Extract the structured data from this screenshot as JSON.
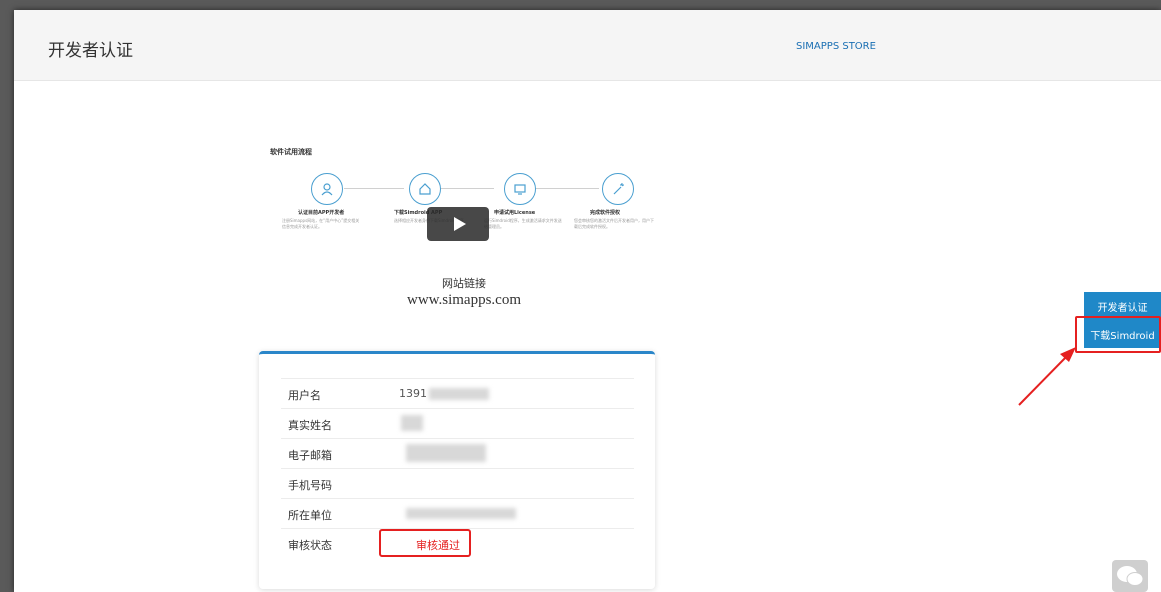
{
  "header": {
    "title": "开发者认证",
    "store_link": "SIMAPPS STORE"
  },
  "flow": {
    "title": "软件试用流程",
    "steps": [
      {
        "title": "认证目前APP开发者",
        "desc": "注册Simapps网站，在“用户中心”提交相关信息完成开发者认证。",
        "icon": "user-icon"
      },
      {
        "title": "下载Simdroid APP",
        "desc": "选择相应开发者身份下载Simdroid程序",
        "icon": "home-icon"
      },
      {
        "title": "申请试用License",
        "desc": "运行Simdroid程序，生成激活请求文件发送给管理员。",
        "icon": "monitor-icon"
      },
      {
        "title": "完成软件授权",
        "desc": "您会审核您的激活文件后开发者用户，用户下载后完成软件授权。",
        "icon": "wand-icon"
      }
    ],
    "site_caption_label": "网站链接",
    "site_caption_url": "www.simapps.com"
  },
  "profile": {
    "rows": [
      {
        "label": "用户名",
        "value": "1391"
      },
      {
        "label": "真实姓名",
        "value": ""
      },
      {
        "label": "电子邮箱",
        "value": ""
      },
      {
        "label": "手机号码",
        "value": ""
      },
      {
        "label": "所在单位",
        "value": ""
      },
      {
        "label": "审核状态",
        "value": "审核通过"
      }
    ]
  },
  "side_buttons": {
    "developer_auth": "开发者认证",
    "download_simdroid": "下载Simdroid"
  },
  "colors": {
    "accent": "#1f88c8",
    "highlight": "#e52020"
  }
}
